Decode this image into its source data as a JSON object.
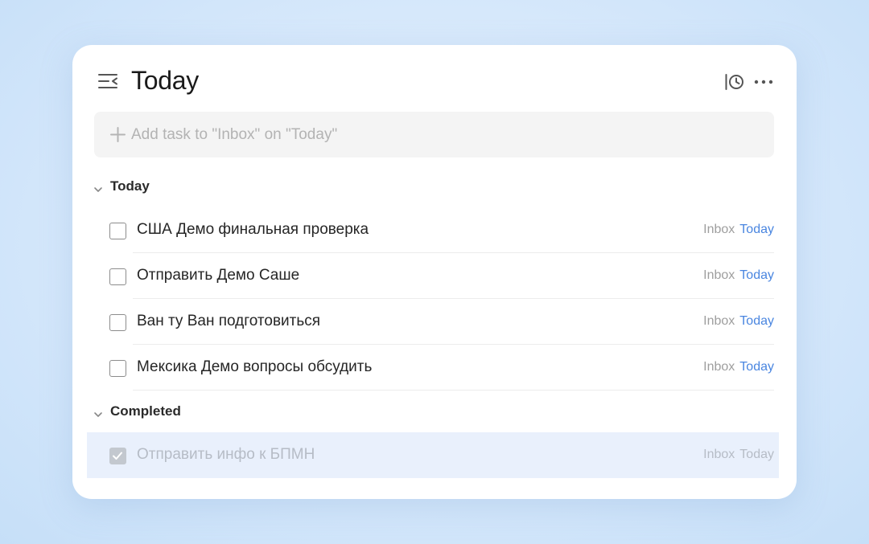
{
  "header": {
    "title": "Today",
    "menu_icon": "menu-collapse-icon",
    "history_icon": "history-icon",
    "more_icon": "more-icon"
  },
  "add_task": {
    "placeholder": "Add task to \"Inbox\" on \"Today\"",
    "value": ""
  },
  "sections": [
    {
      "label": "Today",
      "tasks": [
        {
          "title": "США Демо финальная проверка",
          "project": "Inbox",
          "due": "Today",
          "completed": false
        },
        {
          "title": "Отправить Демо Саше",
          "project": "Inbox",
          "due": "Today",
          "completed": false
        },
        {
          "title": "Ван ту Ван подготовиться",
          "project": "Inbox",
          "due": "Today",
          "completed": false
        },
        {
          "title": "Мексика Демо вопросы обсудить",
          "project": "Inbox",
          "due": "Today",
          "completed": false
        }
      ]
    },
    {
      "label": "Completed",
      "tasks": [
        {
          "title": "Отправить инфо к БПМН",
          "project": "Inbox",
          "due": "Today",
          "completed": true
        }
      ]
    }
  ],
  "colors": {
    "accent": "#4a86e0",
    "muted": "#9e9e9e",
    "completed_row_bg": "#e9f0fc"
  }
}
